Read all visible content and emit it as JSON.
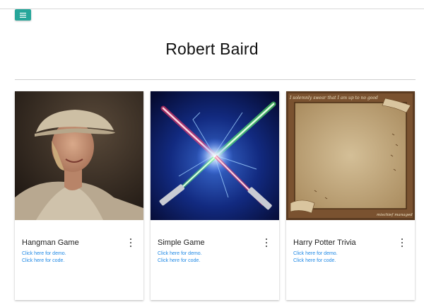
{
  "header": {
    "menu_icon": "hamburger-menu-icon",
    "accent_color": "#26a69a"
  },
  "page": {
    "title": "Robert Baird"
  },
  "cards": [
    {
      "title": "Hangman Game",
      "demo_link": "Click here for demo.",
      "code_link": "Click here for code.",
      "image": "woman-in-hat-photo"
    },
    {
      "title": "Simple Game",
      "demo_link": "Click here for demo.",
      "code_link": "Click here for code.",
      "image": "crossed-lightsabers-image"
    },
    {
      "title": "Harry Potter Trivia",
      "demo_link": "Click here for demo.",
      "code_link": "Click here for code.",
      "image": "marauders-map-parchment-image",
      "image_text_top": "I solemnly swear that I am up to no good",
      "image_text_bottom": "mischief managed"
    }
  ],
  "link_color": "#1e88e5"
}
